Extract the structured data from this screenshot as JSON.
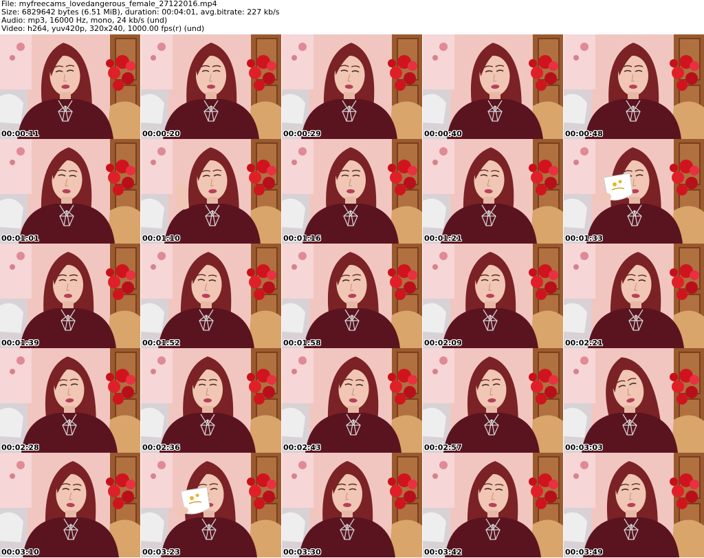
{
  "header": {
    "file_line": "File: myfreecams_lovedangerous_female_27122016.mp4",
    "size_line": "Size: 6829642 bytes (6.51 MiB), duration: 00:04:01, avg.bitrate: 227 kb/s",
    "audio_line": "Audio: mp3, 16000 Hz, mono, 24 kb/s (und)",
    "video_line": "Video: h264, yuv420p, 320x240, 1000.00 fps(r) (und)"
  },
  "colors": {
    "wall": "#f2c6c0",
    "sweater": "#5a1420",
    "hair": "#7a2226",
    "skin": "#f1c6b4",
    "flowers": "#d0141e",
    "door": "#9a5a30",
    "chair": "#d9a56a",
    "necklace": "#d8d8d8",
    "timestamp_text": "#000000",
    "timestamp_outline": "#ffffff"
  },
  "thumbnails": [
    {
      "timestamp": "00:00:11",
      "variant": "default"
    },
    {
      "timestamp": "00:00:20",
      "variant": "default"
    },
    {
      "timestamp": "00:00:29",
      "variant": "default"
    },
    {
      "timestamp": "00:00:40",
      "variant": "default"
    },
    {
      "timestamp": "00:00:48",
      "variant": "default"
    },
    {
      "timestamp": "00:01:01",
      "variant": "default"
    },
    {
      "timestamp": "00:01:10",
      "variant": "hand-on-cheek"
    },
    {
      "timestamp": "00:01:16",
      "variant": "default"
    },
    {
      "timestamp": "00:01:21",
      "variant": "default"
    },
    {
      "timestamp": "00:01:33",
      "variant": "drinking-cup"
    },
    {
      "timestamp": "00:01:39",
      "variant": "default"
    },
    {
      "timestamp": "00:01:52",
      "variant": "default"
    },
    {
      "timestamp": "00:01:58",
      "variant": "default"
    },
    {
      "timestamp": "00:02:09",
      "variant": "default"
    },
    {
      "timestamp": "00:02:21",
      "variant": "default"
    },
    {
      "timestamp": "00:02:28",
      "variant": "default"
    },
    {
      "timestamp": "00:02:36",
      "variant": "default"
    },
    {
      "timestamp": "00:02:43",
      "variant": "default"
    },
    {
      "timestamp": "00:02:57",
      "variant": "default"
    },
    {
      "timestamp": "00:03:03",
      "variant": "head-tilted"
    },
    {
      "timestamp": "00:03:10",
      "variant": "default"
    },
    {
      "timestamp": "00:03:23",
      "variant": "drinking-cup"
    },
    {
      "timestamp": "00:03:30",
      "variant": "default"
    },
    {
      "timestamp": "00:03:42",
      "variant": "default"
    },
    {
      "timestamp": "00:03:49",
      "variant": "default"
    }
  ]
}
